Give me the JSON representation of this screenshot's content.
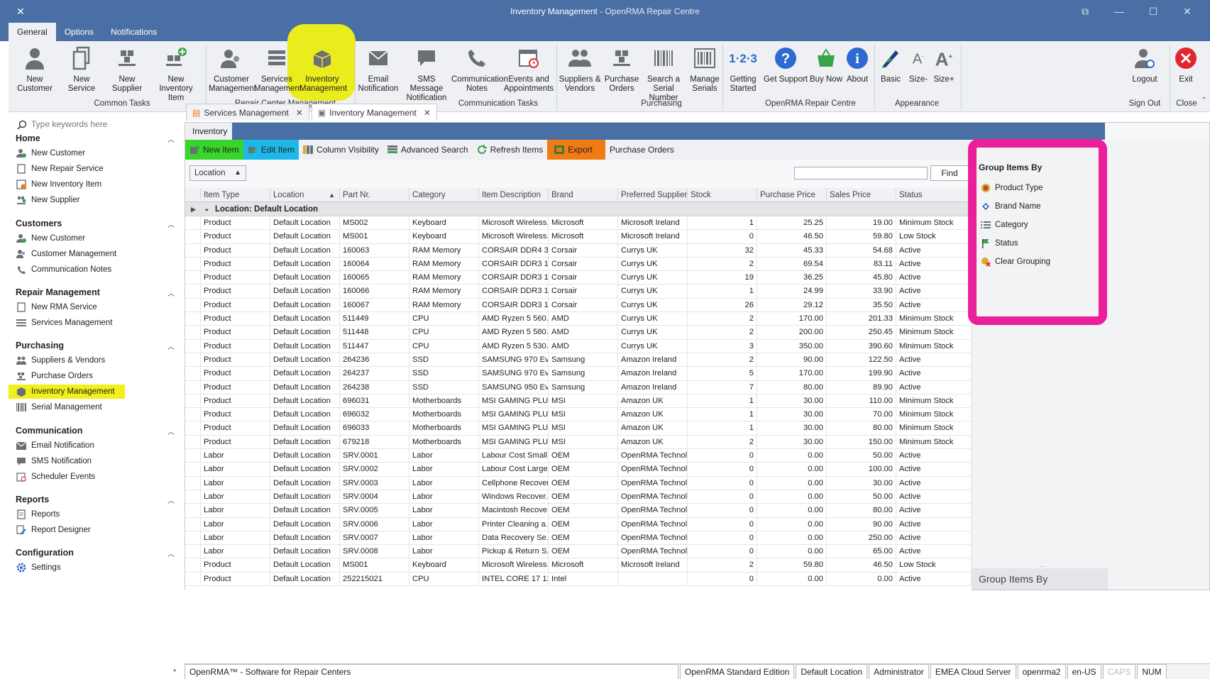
{
  "window": {
    "title": "Inventory Management",
    "subtitle": " - OpenRMA Repair Centre"
  },
  "menu_tabs": [
    "General",
    "Options",
    "Notifications"
  ],
  "ribbon": {
    "buttons": [
      {
        "label": "New Customer",
        "icon": "person-icon"
      },
      {
        "label": "New Service",
        "icon": "document-icon"
      },
      {
        "label": "New Supplier",
        "icon": "warehouse-icon"
      },
      {
        "label": "New Inventory Item",
        "icon": "add-inventory-icon"
      },
      {
        "label": "Customer Management",
        "icon": "people-icon"
      },
      {
        "label": "Services Management",
        "icon": "list-icon"
      },
      {
        "label": "Inventory Management",
        "icon": "boxes-icon"
      },
      {
        "label": "Email Notification",
        "icon": "envelope-icon"
      },
      {
        "label": "SMS Message Notification",
        "icon": "chat-icon"
      },
      {
        "label": "Communication Notes",
        "icon": "phone-icon"
      },
      {
        "label": "Events and Appointments",
        "icon": "calendar-icon"
      },
      {
        "label": "Suppliers & Vendors",
        "icon": "people-icon"
      },
      {
        "label": "Purchase Orders",
        "icon": "warehouse-icon"
      },
      {
        "label": "Search a Serial Number",
        "icon": "barcode-icon"
      },
      {
        "label": "Manage Serials",
        "icon": "barcode-box-icon"
      },
      {
        "label": "Getting Started",
        "icon": "numbers-icon"
      },
      {
        "label": "Get Support",
        "icon": "question-icon"
      },
      {
        "label": "Buy Now",
        "icon": "cart-icon"
      },
      {
        "label": "About",
        "icon": "info-icon"
      },
      {
        "label": "Basic",
        "icon": "brush-icon"
      },
      {
        "label": "Size-",
        "icon": "font-smaller-icon"
      },
      {
        "label": "Size+",
        "icon": "font-larger-icon"
      },
      {
        "label": "Logout",
        "icon": "logout-icon"
      },
      {
        "label": "Exit",
        "icon": "close-circle-icon"
      }
    ],
    "groups": [
      "Common Tasks",
      "Repair Center Management",
      "Communication Tasks",
      "Purchasing",
      "OpenRMA Repair Centre",
      "Appearance",
      "Sign Out",
      "Close"
    ]
  },
  "sidebar": {
    "search_placeholder": "Type keywords here",
    "sections": [
      {
        "title": "Home",
        "items": [
          "New Customer",
          "New Repair Service",
          "New Inventory Item",
          "New Supplier"
        ]
      },
      {
        "title": "Customers",
        "items": [
          "New Customer",
          "Customer Management",
          "Communication Notes"
        ]
      },
      {
        "title": "Repair Management",
        "items": [
          "New RMA Service",
          "Services Management"
        ]
      },
      {
        "title": "Purchasing",
        "items": [
          "Suppliers & Vendors",
          "Purchase Orders",
          "Inventory Management",
          "Serial Management"
        ]
      },
      {
        "title": "Communication",
        "items": [
          "Email Notification",
          "SMS Notification",
          "Scheduler Events"
        ]
      },
      {
        "title": "Reports",
        "items": [
          "Reports",
          "Report Designer"
        ]
      },
      {
        "title": "Configuration",
        "items": [
          "Settings"
        ]
      }
    ],
    "selected": "Inventory Management"
  },
  "doc_tabs": [
    "Services Management",
    "Inventory Management"
  ],
  "inventory": {
    "header": "Inventory",
    "toolbar": [
      "New Item",
      "Edit Item",
      "Column Visibility",
      "Advanced Search",
      "Refresh Items",
      "Export",
      "Purchase Orders"
    ],
    "group_chip": "Location",
    "find_label": "Find",
    "columns": [
      "Item Type",
      "Location",
      "Part Nr.",
      "Category",
      "Item Description",
      "Brand",
      "Preferred Supplier",
      "Stock",
      "Purchase Price",
      "Sales Price",
      "Status"
    ],
    "group_row": "Location: Default Location",
    "rows": [
      [
        "Product",
        "Default Location",
        "MS002",
        "Keyboard",
        "Microsoft Wireless...",
        "Microsoft",
        "Microsoft Ireland",
        "1",
        "25.25",
        "19.00",
        "Minimum Stock"
      ],
      [
        "Product",
        "Default Location",
        "MS001",
        "Keyboard",
        "Microsoft Wireless...",
        "Microsoft",
        "Microsoft Ireland",
        "0",
        "46.50",
        "59.80",
        "Low Stock"
      ],
      [
        "Product",
        "Default Location",
        "160063",
        "RAM Memory",
        "CORSAIR DDR4 3...",
        "Corsair",
        "Currys UK",
        "32",
        "45.33",
        "54.68",
        "Active"
      ],
      [
        "Product",
        "Default Location",
        "160064",
        "RAM Memory",
        "CORSAIR DDR3 1...",
        "Corsair",
        "Currys UK",
        "2",
        "69.54",
        "83.11",
        "Active"
      ],
      [
        "Product",
        "Default Location",
        "160065",
        "RAM Memory",
        "CORSAIR DDR3 1...",
        "Corsair",
        "Currys UK",
        "19",
        "36.25",
        "45.80",
        "Active"
      ],
      [
        "Product",
        "Default Location",
        "160066",
        "RAM Memory",
        "CORSAIR DDR3 1...",
        "Corsair",
        "Currys UK",
        "1",
        "24.99",
        "33.90",
        "Active"
      ],
      [
        "Product",
        "Default Location",
        "160067",
        "RAM Memory",
        "CORSAIR DDR3 1...",
        "Corsair",
        "Currys UK",
        "26",
        "29.12",
        "35.50",
        "Active"
      ],
      [
        "Product",
        "Default Location",
        "511449",
        "CPU",
        "AMD Ryzen 5 560...",
        "AMD",
        "Currys UK",
        "2",
        "170.00",
        "201.33",
        "Minimum Stock"
      ],
      [
        "Product",
        "Default Location",
        "511448",
        "CPU",
        "AMD Ryzen 5 580...",
        "AMD",
        "Currys UK",
        "2",
        "200.00",
        "250.45",
        "Minimum Stock"
      ],
      [
        "Product",
        "Default Location",
        "511447",
        "CPU",
        "AMD Ryzen 5 530...",
        "AMD",
        "Currys UK",
        "3",
        "350.00",
        "390.60",
        "Minimum Stock"
      ],
      [
        "Product",
        "Default Location",
        "264236",
        "SSD",
        "SAMSUNG 970 Evo...",
        "Samsung",
        "Amazon Ireland",
        "2",
        "90.00",
        "122.50",
        "Active"
      ],
      [
        "Product",
        "Default Location",
        "264237",
        "SSD",
        "SAMSUNG 970 Evo...",
        "Samsung",
        "Amazon Ireland",
        "5",
        "170.00",
        "199.90",
        "Active"
      ],
      [
        "Product",
        "Default Location",
        "264238",
        "SSD",
        "SAMSUNG 950 Evo...",
        "Samsung",
        "Amazon Ireland",
        "7",
        "80.00",
        "89.90",
        "Active"
      ],
      [
        "Product",
        "Default Location",
        "696031",
        "Motherboards",
        "MSI GAMING PLUS...",
        "MSI",
        "Amazon UK",
        "1",
        "30.00",
        "110.00",
        "Minimum Stock"
      ],
      [
        "Product",
        "Default Location",
        "696032",
        "Motherboards",
        "MSI GAMING PLUS...",
        "MSI",
        "Amazon UK",
        "1",
        "30.00",
        "70.00",
        "Minimum Stock"
      ],
      [
        "Product",
        "Default Location",
        "696033",
        "Motherboards",
        "MSI GAMING PLUS...",
        "MSI",
        "Amazon UK",
        "1",
        "30.00",
        "80.00",
        "Minimum Stock"
      ],
      [
        "Product",
        "Default Location",
        "679218",
        "Motherboards",
        "MSI GAMING PLUS...",
        "MSI",
        "Amazon UK",
        "2",
        "30.00",
        "150.00",
        "Minimum Stock"
      ],
      [
        "Labor",
        "Default Location",
        "SRV.0001",
        "Labor",
        "Labour Cost Small...",
        "OEM",
        "OpenRMA Technol...",
        "0",
        "0.00",
        "50.00",
        "Active"
      ],
      [
        "Labor",
        "Default Location",
        "SRV.0002",
        "Labor",
        "Labour Cost Large...",
        "OEM",
        "OpenRMA Technol...",
        "0",
        "0.00",
        "100.00",
        "Active"
      ],
      [
        "Labor",
        "Default Location",
        "SRV.0003",
        "Labor",
        "Cellphone Recover...",
        "OEM",
        "OpenRMA Technol...",
        "0",
        "0.00",
        "30.00",
        "Active"
      ],
      [
        "Labor",
        "Default Location",
        "SRV.0004",
        "Labor",
        "Windows Recover...",
        "OEM",
        "OpenRMA Technol...",
        "0",
        "0.00",
        "50.00",
        "Active"
      ],
      [
        "Labor",
        "Default Location",
        "SRV.0005",
        "Labor",
        "Macintosh Recove...",
        "OEM",
        "OpenRMA Technol...",
        "0",
        "0.00",
        "80.00",
        "Active"
      ],
      [
        "Labor",
        "Default Location",
        "SRV.0006",
        "Labor",
        "Printer Cleaning a...",
        "OEM",
        "OpenRMA Technol...",
        "0",
        "0.00",
        "90.00",
        "Active"
      ],
      [
        "Labor",
        "Default Location",
        "SRV.0007",
        "Labor",
        "Data Recovery Se...",
        "OEM",
        "OpenRMA Technol...",
        "0",
        "0.00",
        "250.00",
        "Active"
      ],
      [
        "Labor",
        "Default Location",
        "SRV.0008",
        "Labor",
        "Pickup & Return S...",
        "OEM",
        "OpenRMA Technol...",
        "0",
        "0.00",
        "65.00",
        "Active"
      ],
      [
        "Product",
        "Default Location",
        "MS001",
        "Keyboard",
        "Microsoft Wireless...",
        "Microsoft",
        "Microsoft Ireland",
        "2",
        "59.80",
        "46.50",
        "Low Stock"
      ],
      [
        "Product",
        "Default Location",
        "252215021",
        "CPU",
        "INTEL CORE 17 12...",
        "Intel",
        "",
        "0",
        "0.00",
        "0.00",
        "Active"
      ]
    ]
  },
  "group_panel": {
    "title": "Group Items By",
    "items": [
      {
        "label": "Product Type",
        "icon": "product-type-icon"
      },
      {
        "label": "Brand Name",
        "icon": "brand-icon"
      },
      {
        "label": "Category",
        "icon": "category-icon"
      },
      {
        "label": "Status",
        "icon": "flag-icon"
      },
      {
        "label": "Clear Grouping",
        "icon": "clear-icon"
      }
    ],
    "footer": "Group Items By"
  },
  "statusbar": [
    "OpenRMA™ - Software for Repair Centers",
    "OpenRMA Standard Edition",
    "Default Location",
    "Administrator",
    "EMEA Cloud Server",
    "openrma2",
    "en-US",
    "CAPS",
    "NUM"
  ],
  "colors": {
    "accent": "#4a6fa5",
    "highlight_yellow": "#eaec1c",
    "highlight_green": "#38d62a",
    "highlight_cyan": "#1db8e8",
    "highlight_orange": "#f07a14",
    "highlight_magenta": "#ec1f9a"
  }
}
